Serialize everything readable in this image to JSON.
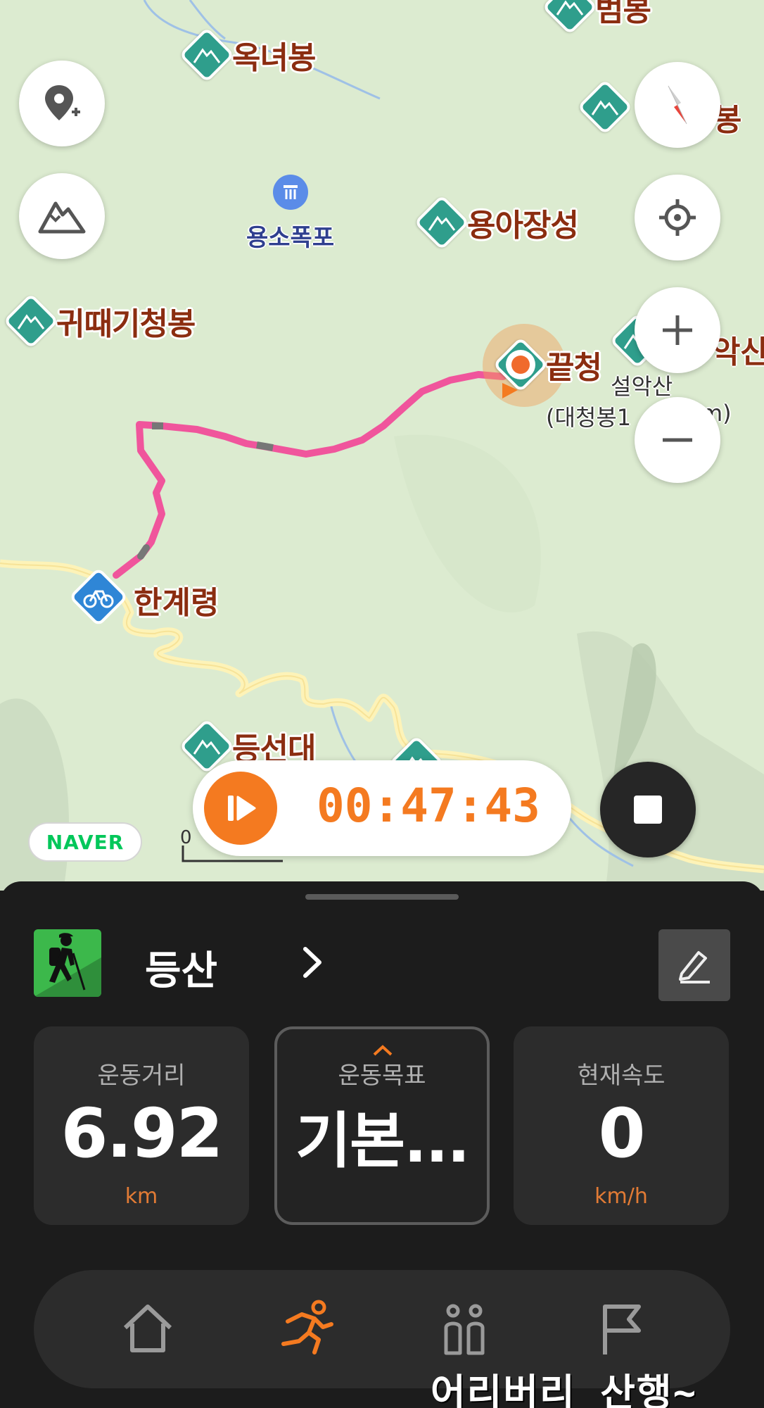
{
  "map": {
    "peaks": [
      {
        "name": "옥녀봉"
      },
      {
        "name": "범봉"
      },
      {
        "name": "용아장성"
      },
      {
        "name": "귀때기청봉"
      },
      {
        "name": "끝청"
      },
      {
        "name": "등선대"
      },
      {
        "name": "봉"
      },
      {
        "name": "악산"
      }
    ],
    "waterfall_label": "용소폭포",
    "seorak_label": "설악산",
    "seorak_sub": "(대청봉1",
    "seorak_sub_tail": "m)",
    "pass_label": "한계령",
    "naver_logo": "NAVER",
    "scale_zero": "0",
    "icons": {
      "add_place": "add-place-pin-icon",
      "terrain": "mountain-icon",
      "compass": "compass-icon",
      "locate": "locate-crosshair-icon",
      "zoom_in": "plus-icon",
      "zoom_out": "minus-icon"
    }
  },
  "tracking": {
    "elapsed": "00:47:43",
    "accent_color": "#f47a20"
  },
  "activity": {
    "name": "등산",
    "icon": "hiker-icon"
  },
  "stats": [
    {
      "label": "운동거리",
      "value": "6.92",
      "unit": "km"
    },
    {
      "label": "운동목표",
      "value": "기본...",
      "unit": ""
    },
    {
      "label": "현재속도",
      "value": "0",
      "unit": "km/h"
    }
  ],
  "nav": {
    "items": [
      {
        "icon": "home-icon",
        "active": false
      },
      {
        "icon": "runner-icon",
        "active": true
      },
      {
        "icon": "people-icon",
        "active": false
      },
      {
        "icon": "flag-icon",
        "active": false
      }
    ]
  },
  "watermark": "어리버리 산행~"
}
